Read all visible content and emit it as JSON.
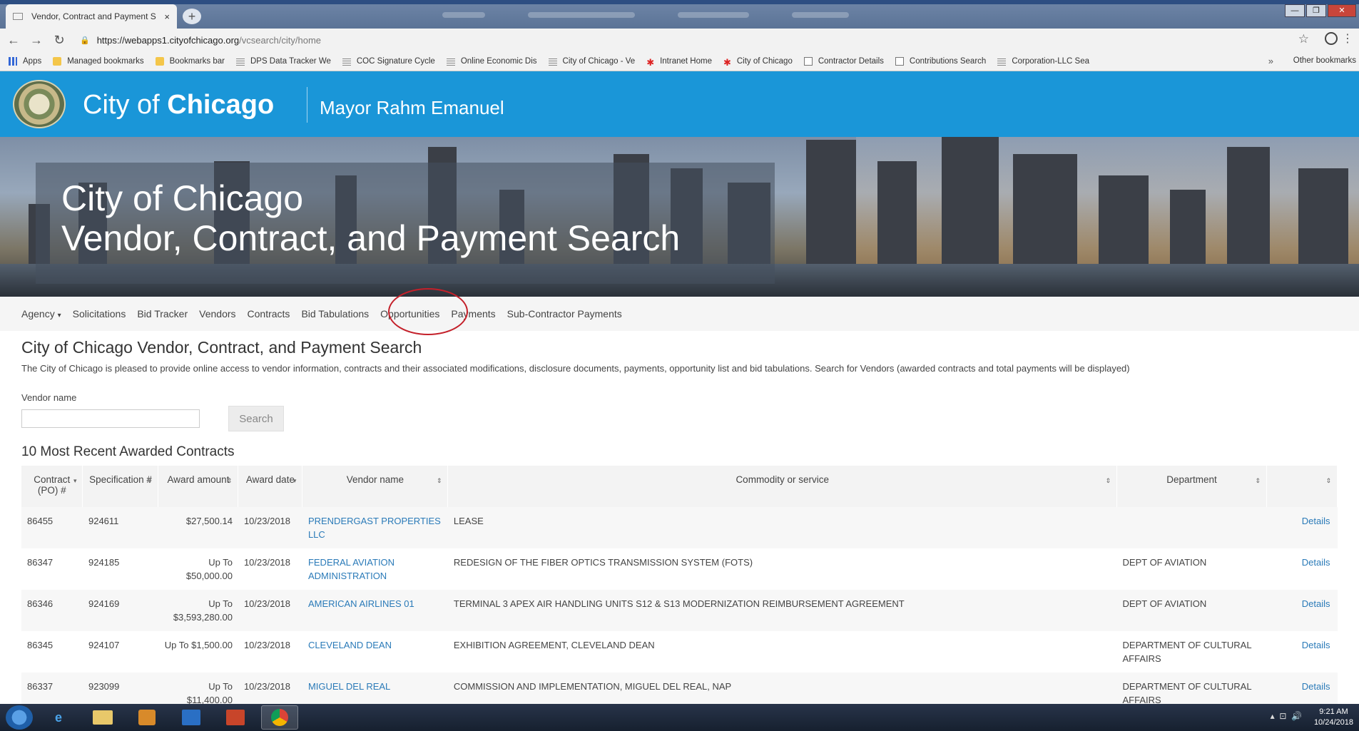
{
  "browser": {
    "tab_title": "Vendor, Contract and Payment S",
    "tab_close": "×",
    "new_tab": "+",
    "url_host": "https://webapps1.cityofchicago.org",
    "url_path": "/vcsearch/city/home",
    "bookmarks": [
      {
        "label": "Apps",
        "icon": "apps-icon"
      },
      {
        "label": "Managed bookmarks",
        "icon": "folder-icon"
      },
      {
        "label": "Bookmarks bar",
        "icon": "folder-icon"
      },
      {
        "label": "DPS Data Tracker We",
        "icon": "page-icon"
      },
      {
        "label": "COC Signature Cycle",
        "icon": "page-icon"
      },
      {
        "label": "Online Economic Dis",
        "icon": "page-icon"
      },
      {
        "label": "City of Chicago - Ve",
        "icon": "page-icon"
      },
      {
        "label": "Intranet Home",
        "icon": "star-icon"
      },
      {
        "label": "City of Chicago",
        "icon": "star-icon"
      },
      {
        "label": "Contractor Details",
        "icon": "doc-icon"
      },
      {
        "label": "Contributions Search",
        "icon": "doc-icon"
      },
      {
        "label": "Corporation-LLC Sea",
        "icon": "page-icon"
      }
    ],
    "bookmarks_more": "»",
    "other_bookmarks": "Other bookmarks"
  },
  "header": {
    "brand_prefix": "City of",
    "brand_bold": "Chicago",
    "mayor": "Mayor Rahm Emanuel"
  },
  "hero": {
    "line1": "City of Chicago",
    "line2": "Vendor, Contract, and Payment Search"
  },
  "nav": {
    "items": [
      "Agency",
      "Solicitations",
      "Bid Tracker",
      "Vendors",
      "Contracts",
      "Bid Tabulations",
      "Opportunities",
      "Payments",
      "Sub-Contractor Payments"
    ],
    "agency_caret": "▾"
  },
  "main": {
    "title": "City of Chicago Vendor, Contract, and Payment Search",
    "intro": "The City of Chicago is pleased to provide online access to vendor information, contracts and their associated modifications, disclosure documents, payments, opportunity list and bid tabulations. Search for Vendors (awarded contracts and total payments will be displayed)",
    "vendor_label": "Vendor name",
    "vendor_value": "",
    "search_label": "Search",
    "recent_title": "10 Most Recent Awarded Contracts"
  },
  "table": {
    "headers": [
      "Contract (PO) #",
      "Specification #",
      "Award amount",
      "Award date",
      "Vendor name",
      "Commodity or service",
      "Department",
      ""
    ],
    "rows": [
      {
        "po": "86455",
        "spec": "924611",
        "amount": "$27,500.14",
        "date": "10/23/2018",
        "vendor": "PRENDERGAST PROPERTIES LLC",
        "commodity": "LEASE",
        "dept": "",
        "details": "Details"
      },
      {
        "po": "86347",
        "spec": "924185",
        "amount": "Up To $50,000.00",
        "date": "10/23/2018",
        "vendor": "FEDERAL AVIATION ADMINISTRATION",
        "commodity": "REDESIGN OF THE FIBER OPTICS TRANSMISSION SYSTEM (FOTS)",
        "dept": "DEPT OF AVIATION",
        "details": "Details"
      },
      {
        "po": "86346",
        "spec": "924169",
        "amount": "Up To $3,593,280.00",
        "date": "10/23/2018",
        "vendor": "AMERICAN AIRLINES 01",
        "commodity": "TERMINAL 3 APEX AIR HANDLING UNITS S12 & S13 MODERNIZATION REIMBURSEMENT AGREEMENT",
        "dept": "DEPT OF AVIATION",
        "details": "Details"
      },
      {
        "po": "86345",
        "spec": "924107",
        "amount": "Up To $1,500.00",
        "date": "10/23/2018",
        "vendor": "CLEVELAND DEAN",
        "commodity": "EXHIBITION AGREEMENT, CLEVELAND DEAN",
        "dept": "DEPARTMENT OF CULTURAL AFFAIRS",
        "details": "Details"
      },
      {
        "po": "86337",
        "spec": "923099",
        "amount": "Up To $11,400.00",
        "date": "10/23/2018",
        "vendor": "MIGUEL DEL REAL",
        "commodity": "COMMISSION AND IMPLEMENTATION, MIGUEL DEL REAL, NAP",
        "dept": "DEPARTMENT OF CULTURAL AFFAIRS",
        "details": "Details"
      }
    ]
  },
  "taskbar": {
    "time": "9:21 AM",
    "date": "10/24/2018"
  },
  "colors": {
    "header_blue": "#1a96d8",
    "link_blue": "#2a7ab8",
    "annotation_red": "#c4202a"
  }
}
